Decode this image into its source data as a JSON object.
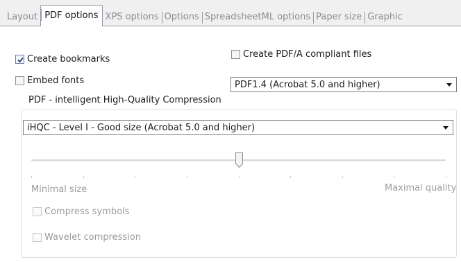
{
  "tabs": [
    {
      "label": "Layout",
      "active": false
    },
    {
      "label": "PDF options",
      "active": true
    },
    {
      "label": "XPS options",
      "active": false
    },
    {
      "label": "Options",
      "active": false
    },
    {
      "label": "SpreadsheetML options",
      "active": false
    },
    {
      "label": "Paper size",
      "active": false
    },
    {
      "label": "Graphic",
      "active": false
    }
  ],
  "options": {
    "create_bookmarks": {
      "label": "Create bookmarks",
      "checked": true
    },
    "embed_fonts": {
      "label": "Embed fonts",
      "checked": false
    },
    "pdfa": {
      "label": "Create PDF/A compliant files",
      "checked": false
    },
    "pdf_version": {
      "selected": "PDF1.4 (Acrobat 5.0 and higher)"
    }
  },
  "compression": {
    "group_label": "PDF - intelligent High-Quality Compression",
    "level_selected": "iHQC - Level I - Good size (Acrobat 5.0 and higher)",
    "slider": {
      "min_label": "Minimal size",
      "max_label": "Maximal quality",
      "value_fraction": 0.5,
      "tick_count": 9
    },
    "compress_symbols": {
      "label": "Compress symbols",
      "checked": false,
      "enabled": false
    },
    "wavelet": {
      "label": "Wavelet compression",
      "checked": false,
      "enabled": false
    }
  },
  "colors": {
    "tab_border": "#8f9aa6",
    "disabled_text": "#9b9b9b",
    "group_border": "#d5dfe5"
  }
}
